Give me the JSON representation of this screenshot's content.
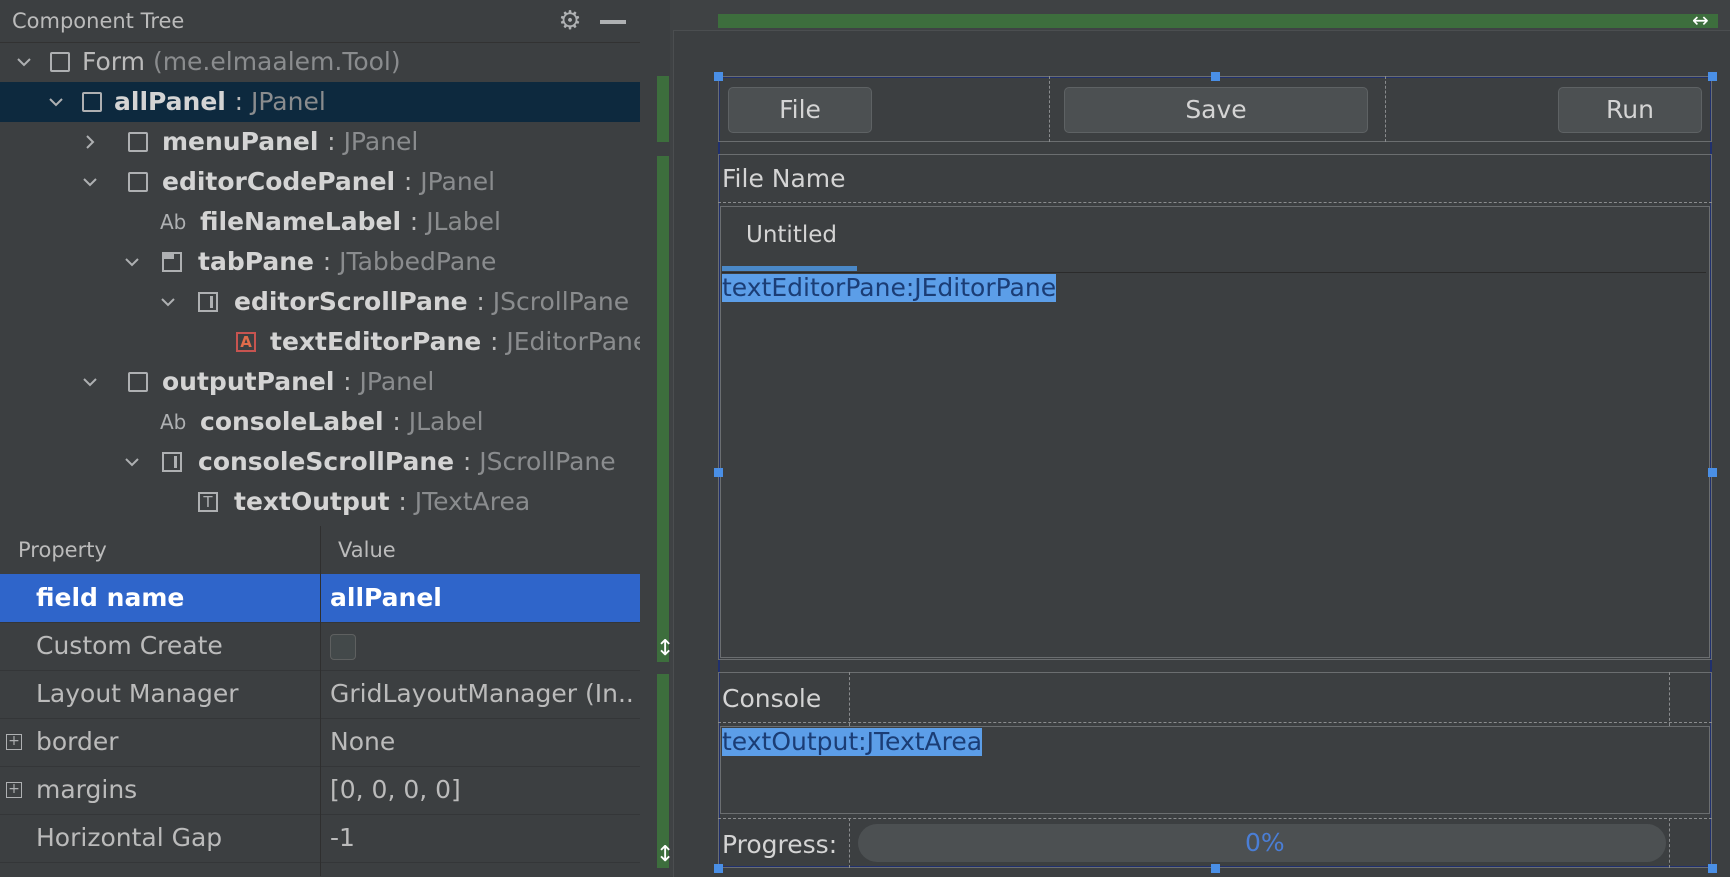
{
  "component_tree": {
    "title": "Component Tree",
    "rows": [
      {
        "name": "Form",
        "type": "(me.elmaalem.Tool)",
        "plain": true
      },
      {
        "name": "allPanel",
        "type": "JPanel",
        "selected": true
      },
      {
        "name": "menuPanel",
        "type": "JPanel"
      },
      {
        "name": "editorCodePanel",
        "type": "JPanel"
      },
      {
        "name": "fileNameLabel",
        "type": "JLabel",
        "icon_text": "Ab"
      },
      {
        "name": "tabPane",
        "type": "JTabbedPane"
      },
      {
        "name": "editorScrollPane",
        "type": "JScrollPane"
      },
      {
        "name": "textEditorPane",
        "type": "JEditorPane",
        "icon_text": "A"
      },
      {
        "name": "outputPanel",
        "type": "JPanel"
      },
      {
        "name": "consoleLabel",
        "type": "JLabel",
        "icon_text": "Ab"
      },
      {
        "name": "consoleScrollPane",
        "type": "JScrollPane"
      },
      {
        "name": "textOutput",
        "type": "JTextArea",
        "icon_text": "T"
      }
    ],
    "separator": ":"
  },
  "properties": {
    "col_property": "Property",
    "col_value": "Value",
    "rows": [
      {
        "name": "field name",
        "value": "allPanel"
      },
      {
        "name": "Custom Create",
        "value": ""
      },
      {
        "name": "Layout Manager",
        "value": "GridLayoutManager (In..."
      },
      {
        "name": "border",
        "value": "None"
      },
      {
        "name": "margins",
        "value": "[0, 0, 0, 0]"
      },
      {
        "name": "Horizontal Gap",
        "value": "-1"
      }
    ],
    "expand_symbol": "+"
  },
  "designer": {
    "file_button": "File",
    "save_button": "Save",
    "run_button": "Run",
    "file_name_label": "File Name",
    "tab_title": "Untitled",
    "editor_placeholder": "textEditorPane:JEditorPane",
    "console_label": "Console",
    "output_placeholder": "textOutput:JTextArea",
    "progress_label": "Progress:",
    "progress_value_text": "0%",
    "progress_fraction": 0,
    "resize_arrow": "↔",
    "vresize_arrow": "↕"
  },
  "colors": {
    "selection_blue": "#2f65ca",
    "tree_selection": "#0d293e",
    "guide_green": "#3d6e3d",
    "handle_blue": "#4a8fe6",
    "text_highlight": "#5c9ee8"
  },
  "icons": {
    "gear": "gear-icon",
    "minimize": "minimize-icon"
  }
}
